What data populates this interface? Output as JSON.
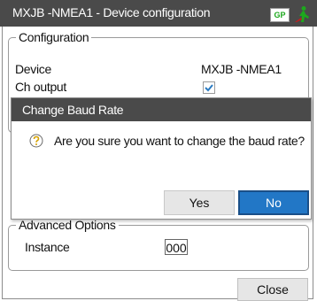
{
  "window": {
    "title": "MXJB -NMEA1 - Device configuration",
    "gps_badge": "GP"
  },
  "configuration": {
    "legend": "Configuration",
    "device_label": "Device",
    "device_value": "MXJB -NMEA1",
    "ch_output_label": "Ch output",
    "ch_output_checked": true
  },
  "advanced": {
    "legend": "Advanced Options",
    "instance_label": "Instance",
    "instance_value": "000"
  },
  "footer": {
    "close_label": "Close"
  },
  "dialog": {
    "title": "Change Baud Rate",
    "message": "Are you sure you want to change the baud rate?",
    "yes_label": "Yes",
    "no_label": "No"
  },
  "colors": {
    "titlebar": "#4a4a4a",
    "primary_button": "#2277c6",
    "gps_badge_text": "#1da81d"
  }
}
